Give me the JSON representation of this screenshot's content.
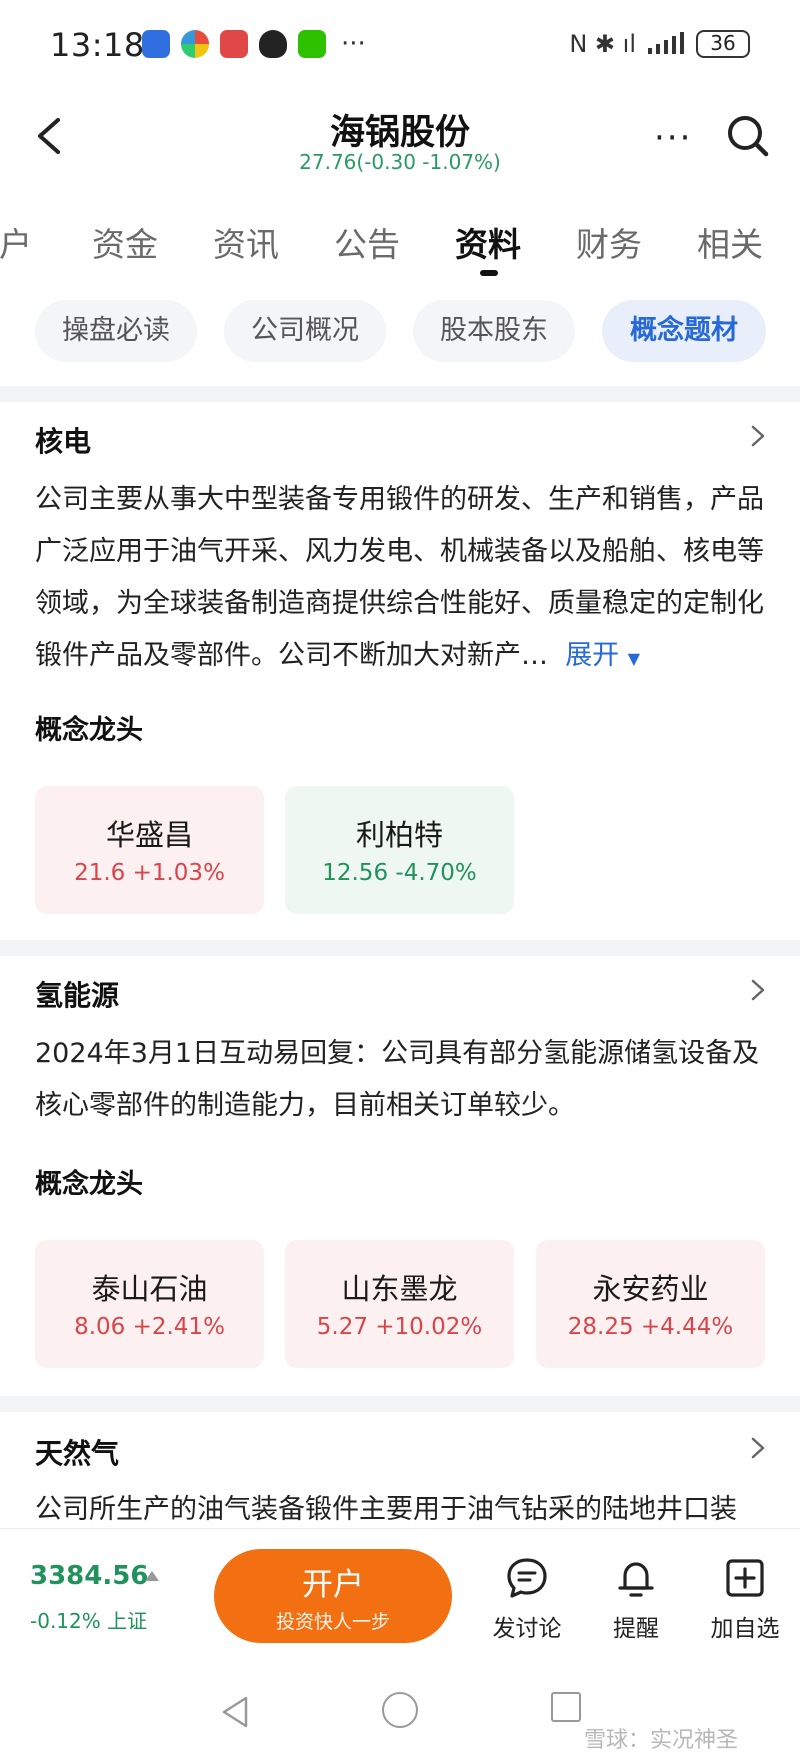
{
  "status_bar": {
    "time": "13:18",
    "right_glyphs": "N ✱ ıl",
    "battery": "36"
  },
  "header": {
    "title": "海锅股份",
    "quote": "27.76(-0.30 -1.07%)",
    "more_glyph": "···"
  },
  "tabs": [
    {
      "label": "开户"
    },
    {
      "label": "资金"
    },
    {
      "label": "资讯"
    },
    {
      "label": "公告"
    },
    {
      "label": "资料"
    },
    {
      "label": "财务"
    },
    {
      "label": "相关"
    }
  ],
  "sub_tabs": [
    {
      "label": "操盘必读"
    },
    {
      "label": "公司概况"
    },
    {
      "label": "股本股东"
    },
    {
      "label": "概念题材"
    }
  ],
  "sections": [
    {
      "title": "核电",
      "description": "公司主要从事大中型装备专用锻件的研发、生产和销售，产品广泛应用于油气开采、风力发电、机械装备以及船舶、核电等领域，为全球装备制造商提供综合性能好、质量稳定的定制化锻件产品及零部件。公司不断加大对新产…",
      "expand_label": "展开",
      "leaders_title": "概念龙头",
      "leaders": [
        {
          "name": "华盛昌",
          "quote": "21.6 +1.03%",
          "direction": "up"
        },
        {
          "name": "利柏特",
          "quote": "12.56 -4.70%",
          "direction": "down"
        }
      ]
    },
    {
      "title": "氢能源",
      "description": "2024年3月1日互动易回复：公司具有部分氢能源储氢设备及核心零部件的制造能力，目前相关订单较少。",
      "leaders_title": "概念龙头",
      "leaders": [
        {
          "name": "泰山石油",
          "quote": "8.06 +2.41%",
          "direction": "up"
        },
        {
          "name": "山东墨龙",
          "quote": "5.27 +10.02%",
          "direction": "up"
        },
        {
          "name": "永安药业",
          "quote": "28.25 +4.44%",
          "direction": "up"
        }
      ]
    },
    {
      "title": "天然气",
      "description": "公司所生产的油气装备锻件主要用于油气钻采的陆地井口装"
    }
  ],
  "bottom_bar": {
    "index_value": "3384.56",
    "index_change": "-0.12%",
    "index_name": "上证",
    "open_account_label": "开户",
    "open_account_sub": "投资快人一步",
    "discuss_label": "发讨论",
    "remind_label": "提醒",
    "watchlist_label": "加自选"
  },
  "watermark": "雪球：实况神圣",
  "colors": {
    "up": "#d8454a",
    "down": "#21925c",
    "accent": "#2769d9",
    "cta": "#f26f12"
  }
}
